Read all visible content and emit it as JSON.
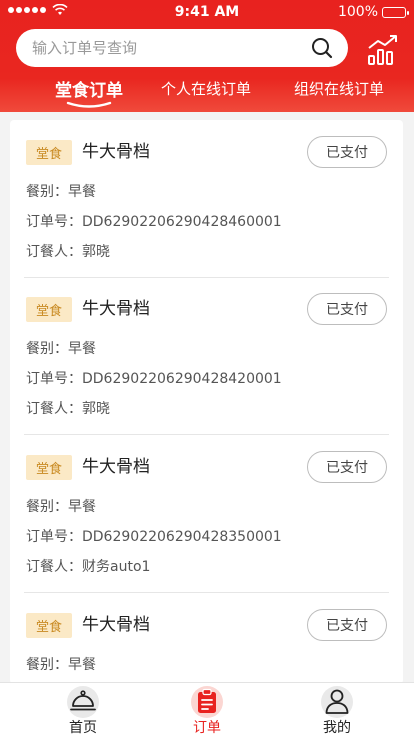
{
  "status_bar": {
    "time": "9:41 AM",
    "battery": "100%"
  },
  "search": {
    "placeholder": "输入订单号查询"
  },
  "tabs": [
    {
      "label": "堂食订单",
      "active": true
    },
    {
      "label": "个人在线订单",
      "active": false
    },
    {
      "label": "组织在线订单",
      "active": false
    }
  ],
  "orders": [
    {
      "tag": "堂食",
      "store": "牛大骨档",
      "status": "已支付",
      "meal_label": "餐别：",
      "meal": "早餐",
      "order_no_label": "订单号：",
      "order_no": "DD62902206290428460001",
      "orderer_label": "订餐人：",
      "orderer": "郭晓"
    },
    {
      "tag": "堂食",
      "store": "牛大骨档",
      "status": "已支付",
      "meal_label": "餐别：",
      "meal": "早餐",
      "order_no_label": "订单号：",
      "order_no": "DD62902206290428420001",
      "orderer_label": "订餐人：",
      "orderer": "郭晓"
    },
    {
      "tag": "堂食",
      "store": "牛大骨档",
      "status": "已支付",
      "meal_label": "餐别：",
      "meal": "早餐",
      "order_no_label": "订单号：",
      "order_no": "DD62902206290428350001",
      "orderer_label": "订餐人：",
      "orderer": "财务auto1"
    },
    {
      "tag": "堂食",
      "store": "牛大骨档",
      "status": "已支付",
      "meal_label": "餐别：",
      "meal": "早餐"
    }
  ],
  "bottom_nav": [
    {
      "label": "首页",
      "icon": "cloche-icon",
      "active": false
    },
    {
      "label": "订单",
      "icon": "clipboard-icon",
      "active": true
    },
    {
      "label": "我的",
      "icon": "user-icon",
      "active": false
    }
  ],
  "colors": {
    "brand_red": "#e8221f",
    "tag_bg": "#fbe9c6",
    "tag_text": "#c98a22"
  }
}
